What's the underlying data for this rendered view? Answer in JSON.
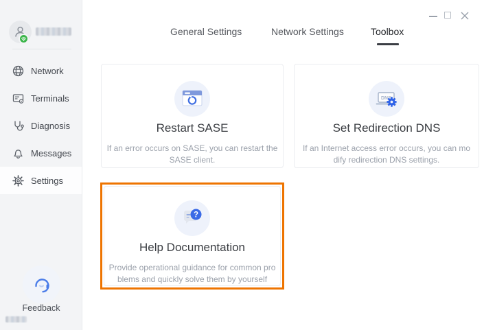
{
  "window": {
    "controls": {
      "minimize": "minimize",
      "maximize": "maximize",
      "close": "close"
    }
  },
  "sidebar": {
    "nav_items": [
      {
        "label": "Network",
        "icon": "globe-icon",
        "active": false
      },
      {
        "label": "Terminals",
        "icon": "terminal-screen-icon",
        "active": false
      },
      {
        "label": "Diagnosis",
        "icon": "stethoscope-icon",
        "active": false
      },
      {
        "label": "Messages",
        "icon": "bell-icon",
        "active": false
      },
      {
        "label": "Settings",
        "icon": "gear-icon",
        "active": true
      }
    ],
    "feedback_label": "Feedback"
  },
  "tabs": [
    {
      "label": "General Settings",
      "active": false
    },
    {
      "label": "Network Settings",
      "active": false
    },
    {
      "label": "Toolbox",
      "active": true
    }
  ],
  "cards": [
    {
      "title": "Restart SASE",
      "description_lines": [
        "If an error occurs on SASE, you can restart the",
        "SASE client."
      ],
      "icon": "restart-window-icon",
      "highlighted": false
    },
    {
      "title": "Set Redirection DNS",
      "description_lines": [
        "If an Internet access error occurs, you can mo",
        "dify redirection DNS settings."
      ],
      "icon": "dns-gear-icon",
      "dns_badge": "DNS",
      "highlighted": false
    },
    {
      "title": "Help Documentation",
      "description_lines": [
        "Provide operational guidance for common pro",
        "blems and quickly solve them by yourself"
      ],
      "icon": "help-chat-icon",
      "highlighted": true
    }
  ],
  "colors": {
    "accent_blue": "#3a6ae6",
    "icon_circle_bg": "#eef2fb",
    "highlight_orange": "#ee7400",
    "status_green": "#3bb54a",
    "sidebar_bg": "#f3f4f6",
    "card_border": "#ebedf0",
    "muted_text": "#9ba1ab"
  }
}
